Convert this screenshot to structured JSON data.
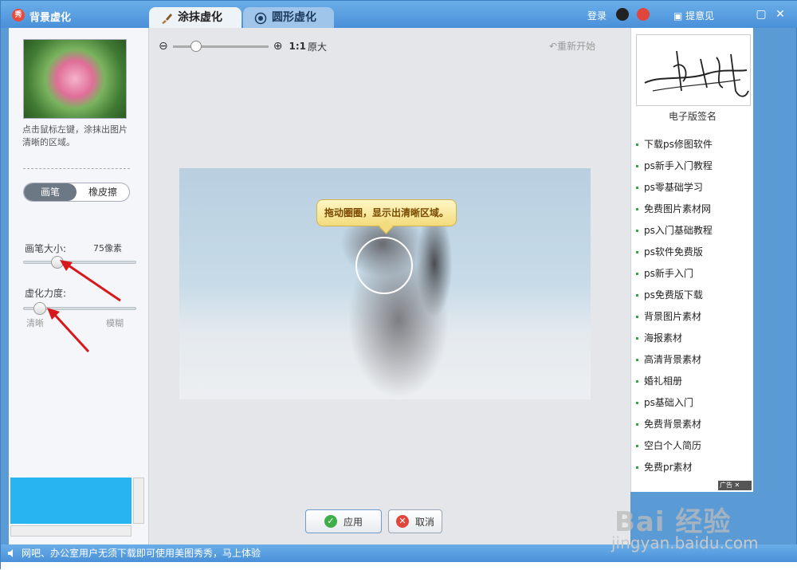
{
  "titlebar": {
    "app_title": "背景虚化",
    "tabs": [
      {
        "label": "涂抹虚化",
        "active": true
      },
      {
        "label": "圆形虚化",
        "active": false
      }
    ],
    "login": "登录",
    "feedback": "提意见"
  },
  "left": {
    "hint": "点击鼠标左键，涂抹出图片清晰的区域。",
    "modes": [
      "画笔",
      "橡皮擦"
    ],
    "brush_size_label": "画笔大小:",
    "brush_size_value": "75像素",
    "blur_label": "虚化力度:",
    "blur_min_label": "清晰",
    "blur_max_label": "模糊",
    "brush_size_fraction": 0.3,
    "blur_fraction": 0.15,
    "preview_color": "#27b4f0"
  },
  "center": {
    "zoom_text": "1:1",
    "zoom_original": "原大",
    "restart": "重新开始",
    "tooltip": "拖动圈圈，显示出清晰区域。",
    "apply": "应用",
    "cancel": "取消"
  },
  "right": {
    "signature_caption": "电子版签名",
    "links": [
      "下载ps修图软件",
      "ps新手入门教程",
      "ps零基础学习",
      "免费图片素材网",
      "ps入门基础教程",
      "ps软件免费版",
      "ps新手入门",
      "ps免费版下载",
      "背景图片素材",
      "海报素材",
      "高清背景素材",
      "婚礼相册",
      "ps基础入门",
      "免费背景素材",
      "空白个人简历",
      "免费pr素材"
    ],
    "ad_tag": "广告"
  },
  "status": {
    "text": "网吧、办公室用户无须下载即可使用美图秀秀，马上体验"
  },
  "watermark": {
    "main": "Bai 经验",
    "sub": "jingyan.baidu.com"
  }
}
